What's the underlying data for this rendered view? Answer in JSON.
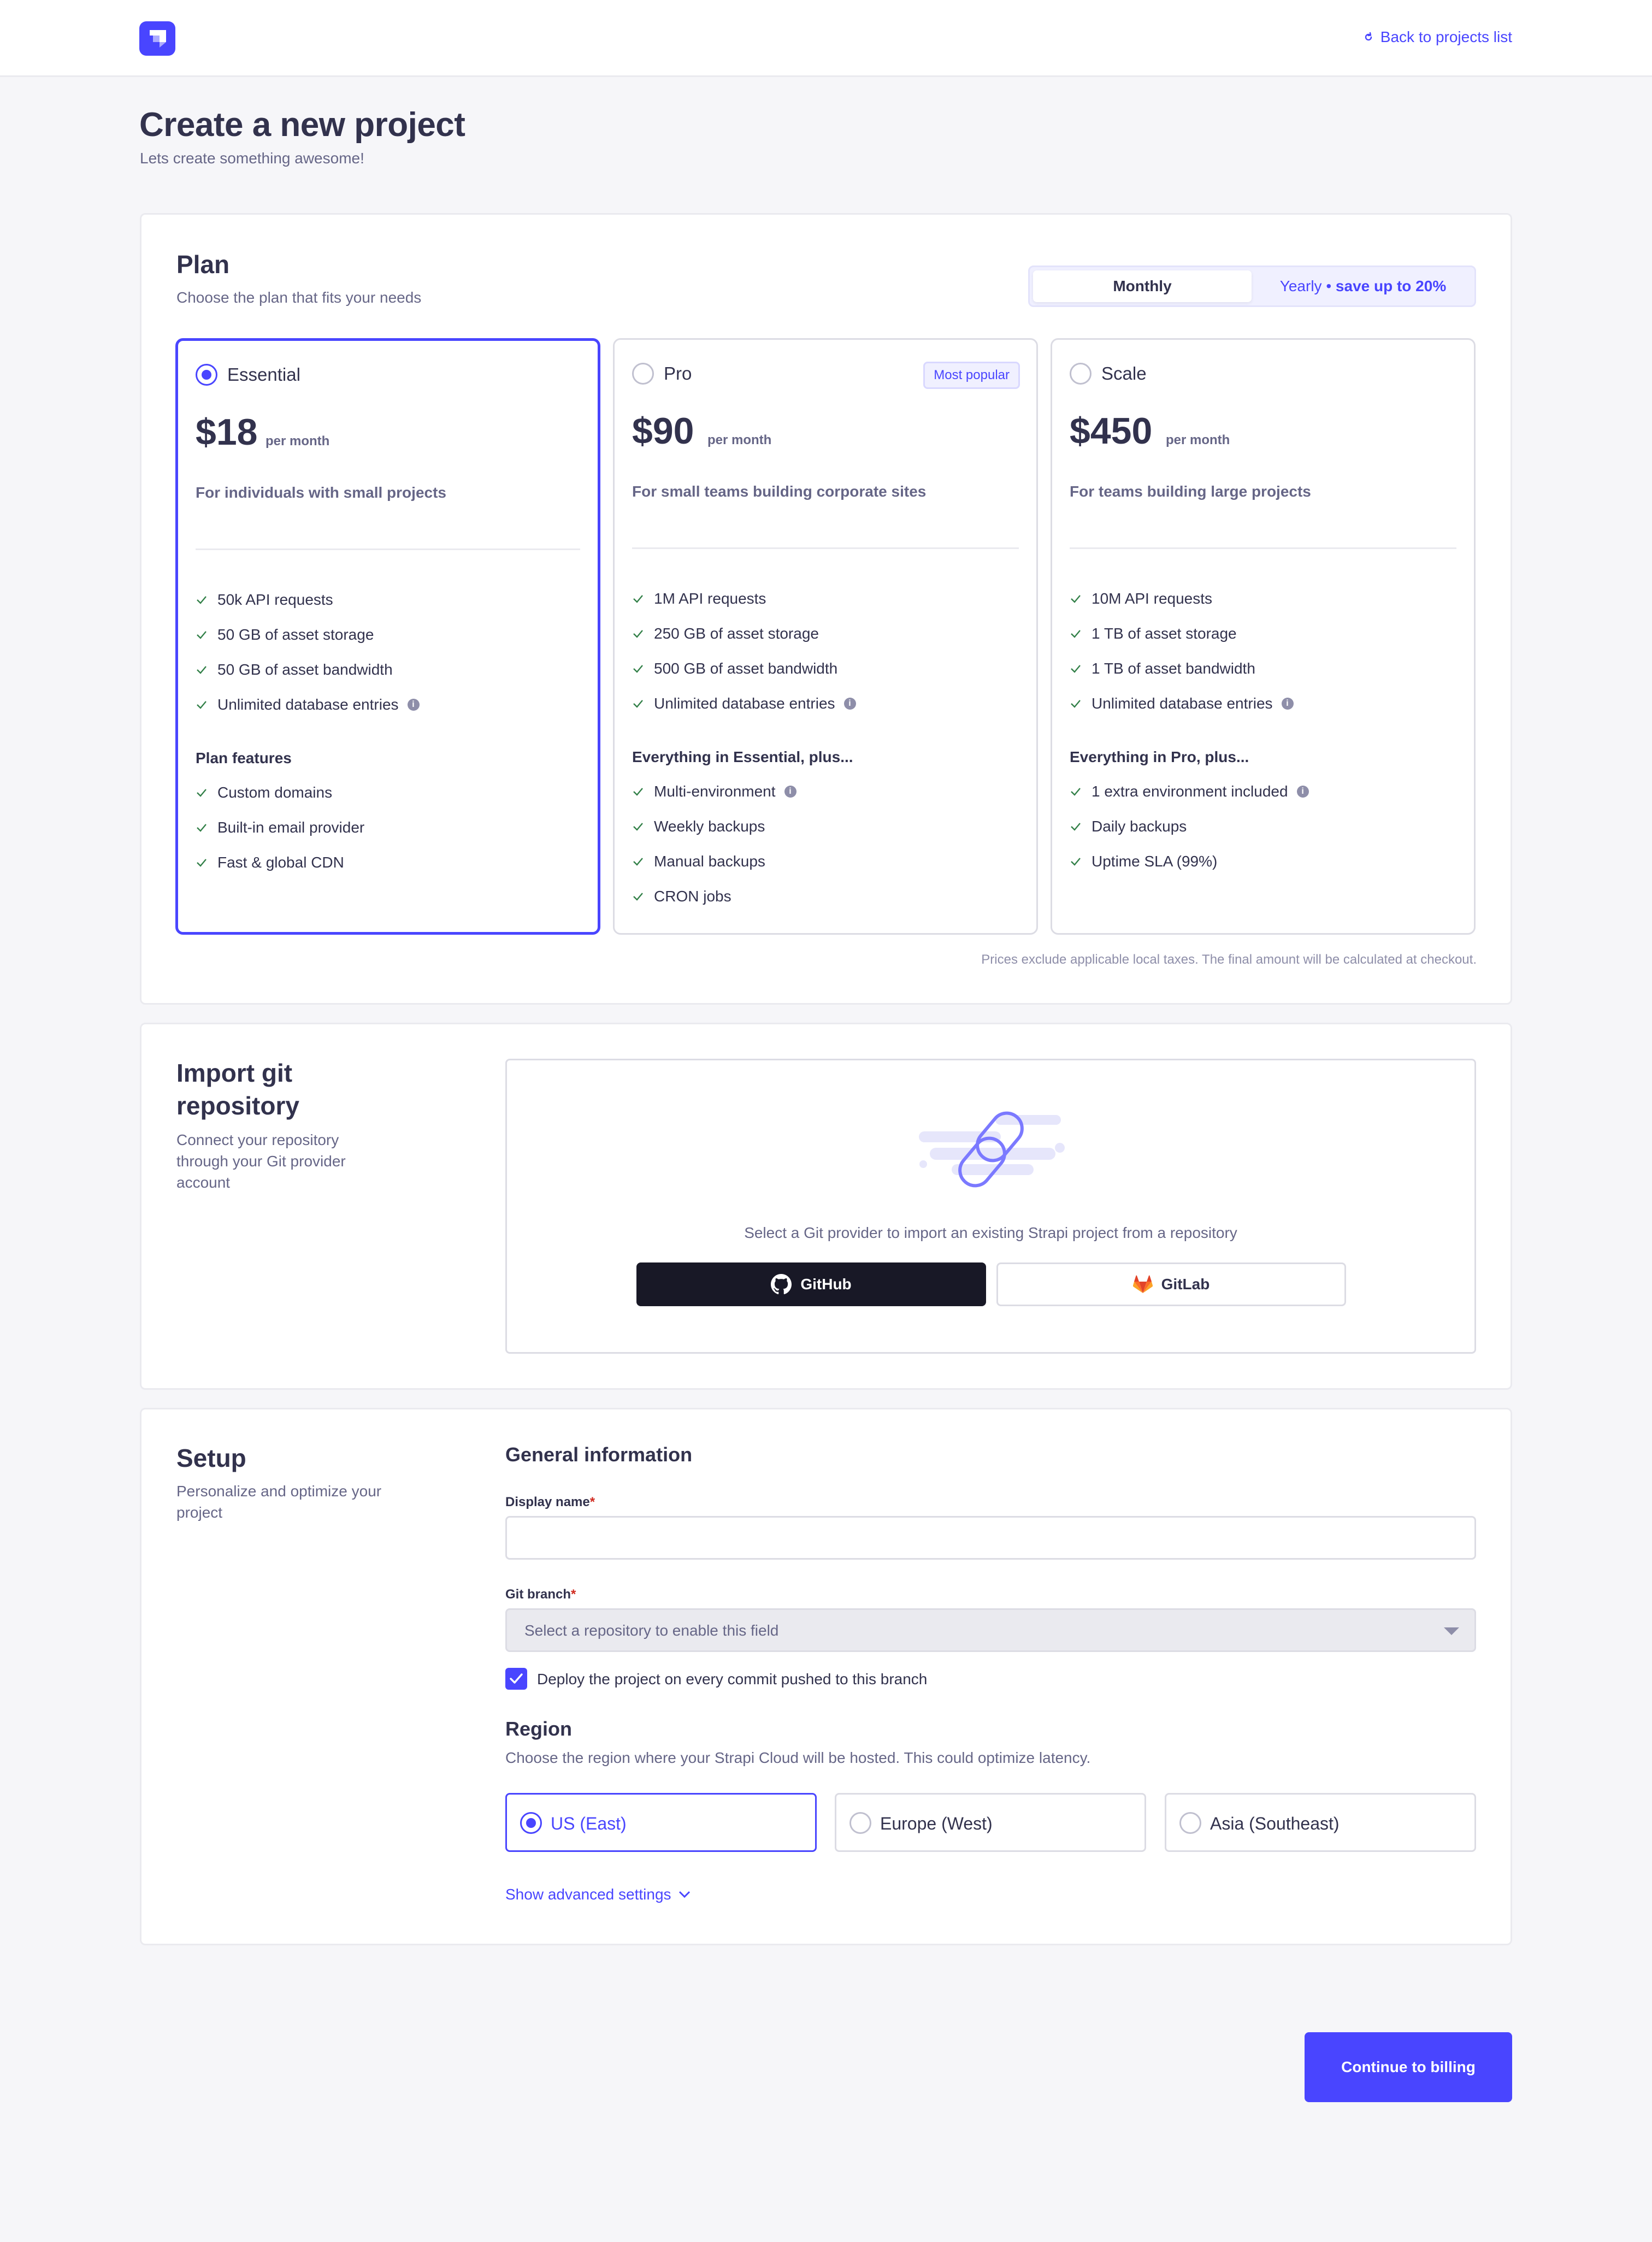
{
  "header": {
    "logo_icon": "strapi-logo-icon",
    "back_link": "Back to projects list"
  },
  "page": {
    "title": "Create a new project",
    "subtitle": "Lets create something awesome!"
  },
  "plan_section": {
    "title": "Plan",
    "subtitle": "Choose the plan that fits your needs",
    "billing_toggle": {
      "monthly": "Monthly",
      "yearly_prefix": "Yearly •",
      "yearly_save": "save up to 20%",
      "selected": "Monthly"
    },
    "plans": [
      {
        "name": "Essential",
        "selected": true,
        "price": "$18",
        "period": "per month",
        "description": "For individuals with small projects",
        "limits": [
          "50k API requests",
          "50 GB of asset storage",
          "50 GB of asset bandwidth",
          "Unlimited database entries"
        ],
        "features_title": "Plan features",
        "features": [
          "Custom domains",
          "Built-in email provider",
          "Fast & global CDN"
        ]
      },
      {
        "name": "Pro",
        "selected": false,
        "badge": "Most popular",
        "price": "$90",
        "period": "per month",
        "description": "For small teams building corporate sites",
        "limits": [
          "1M API requests",
          "250 GB of asset storage",
          "500 GB of asset bandwidth",
          "Unlimited database entries"
        ],
        "features_title": "Everything in Essential, plus...",
        "features": [
          "Multi-environment",
          "Weekly backups",
          "Manual backups",
          "CRON jobs"
        ]
      },
      {
        "name": "Scale",
        "selected": false,
        "price": "$450",
        "period": "per month",
        "description": "For teams building large projects",
        "limits": [
          "10M API requests",
          "1 TB of asset storage",
          "1 TB of asset bandwidth",
          "Unlimited database entries"
        ],
        "features_title": "Everything in Pro, plus...",
        "features": [
          "1 extra environment included",
          "Daily backups",
          "Uptime SLA (99%)"
        ]
      }
    ],
    "tax_note": "Prices exclude applicable local taxes. The final amount will be calculated at checkout."
  },
  "git_section": {
    "title_line1": "Import git",
    "title_line2": "repository",
    "subtitle_line1": "Connect your repository",
    "subtitle_line2": "through your Git provider",
    "subtitle_line3": "account",
    "prompt": "Select a Git provider to import an existing Strapi project from a repository",
    "github_label": "GitHub",
    "gitlab_label": "GitLab"
  },
  "setup_section": {
    "title": "Setup",
    "subtitle_line1": "Personalize and optimize your",
    "subtitle_line2": "project",
    "general_title": "General information",
    "display_name_label": "Display name",
    "display_name_value": "",
    "git_branch_label": "Git branch",
    "git_branch_placeholder": "Select a repository to enable this field",
    "required_mark": "*",
    "deploy_checkbox_label": "Deploy the project on every commit pushed to this branch",
    "deploy_checked": true,
    "region_title": "Region",
    "region_subtitle": "Choose the region where your Strapi Cloud will be hosted. This could optimize latency.",
    "regions": [
      {
        "name": "US (East)",
        "selected": true
      },
      {
        "name": "Europe (West)",
        "selected": false
      },
      {
        "name": "Asia (Southeast)",
        "selected": false
      }
    ],
    "advanced_link": "Show advanced settings"
  },
  "footer": {
    "continue_label": "Continue to billing"
  },
  "colors": {
    "accent": "#4945ff",
    "check": "#328048",
    "required": "#d02b20",
    "dark_button": "#181826"
  }
}
